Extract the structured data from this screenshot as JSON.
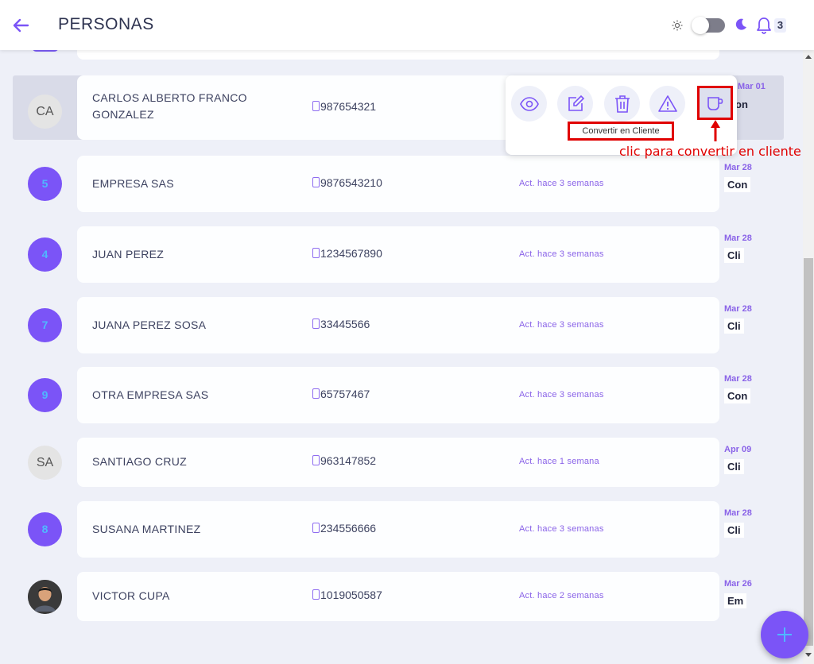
{
  "header": {
    "title": "PERSONAS",
    "notification_count": "3"
  },
  "selected_row": {
    "avatar": "CA",
    "name": "CARLOS ALBERTO FRANCO GONZALEZ",
    "phone": "987654321",
    "date": "Mar 01",
    "tag": "on"
  },
  "popup": {
    "tooltip": "Convertir en Cliente",
    "actions": [
      "view-icon",
      "edit-icon",
      "trash-icon",
      "warning-icon",
      "convert-to-client-icon"
    ]
  },
  "annotation": "clic para convertir en cliente",
  "rows": [
    {
      "avatar": "5",
      "avatar_style": "purple",
      "name": "EMPRESA SAS",
      "phone": "9876543210",
      "activity": "Act. hace 3 semanas",
      "date": "Mar 28",
      "tag": "Con"
    },
    {
      "avatar": "4",
      "avatar_style": "purple",
      "name": "JUAN PEREZ",
      "phone": "1234567890",
      "activity": "Act. hace 3 semanas",
      "date": "Mar 28",
      "tag": "Cli"
    },
    {
      "avatar": "7",
      "avatar_style": "purple",
      "name": "JUANA PEREZ SOSA",
      "phone": "33445566",
      "activity": "Act. hace 3 semanas",
      "date": "Mar 28",
      "tag": "Cli"
    },
    {
      "avatar": "9",
      "avatar_style": "purple",
      "name": "OTRA EMPRESA SAS",
      "phone": "65757467",
      "activity": "Act. hace 3 semanas",
      "date": "Mar 28",
      "tag": "Con"
    },
    {
      "avatar": "SA",
      "avatar_style": "grey",
      "name": "SANTIAGO CRUZ",
      "phone": "963147852",
      "activity": "Act. hace 1 semana",
      "date": "Apr 09",
      "tag": "Cli"
    },
    {
      "avatar": "8",
      "avatar_style": "purple",
      "name": "SUSANA MARTINEZ",
      "phone": "234556666",
      "activity": "Act. hace 3 semanas",
      "date": "Mar 28",
      "tag": "Cli"
    },
    {
      "avatar": "",
      "avatar_style": "photo",
      "name": "VICTOR CUPA",
      "phone": "1019050587",
      "activity": "Act. hace 2 semanas",
      "date": "Mar 26",
      "tag": "Em"
    }
  ],
  "colors": {
    "accent": "#7b54f7",
    "activity": "#8a63e8",
    "annotation": "#e00000"
  }
}
